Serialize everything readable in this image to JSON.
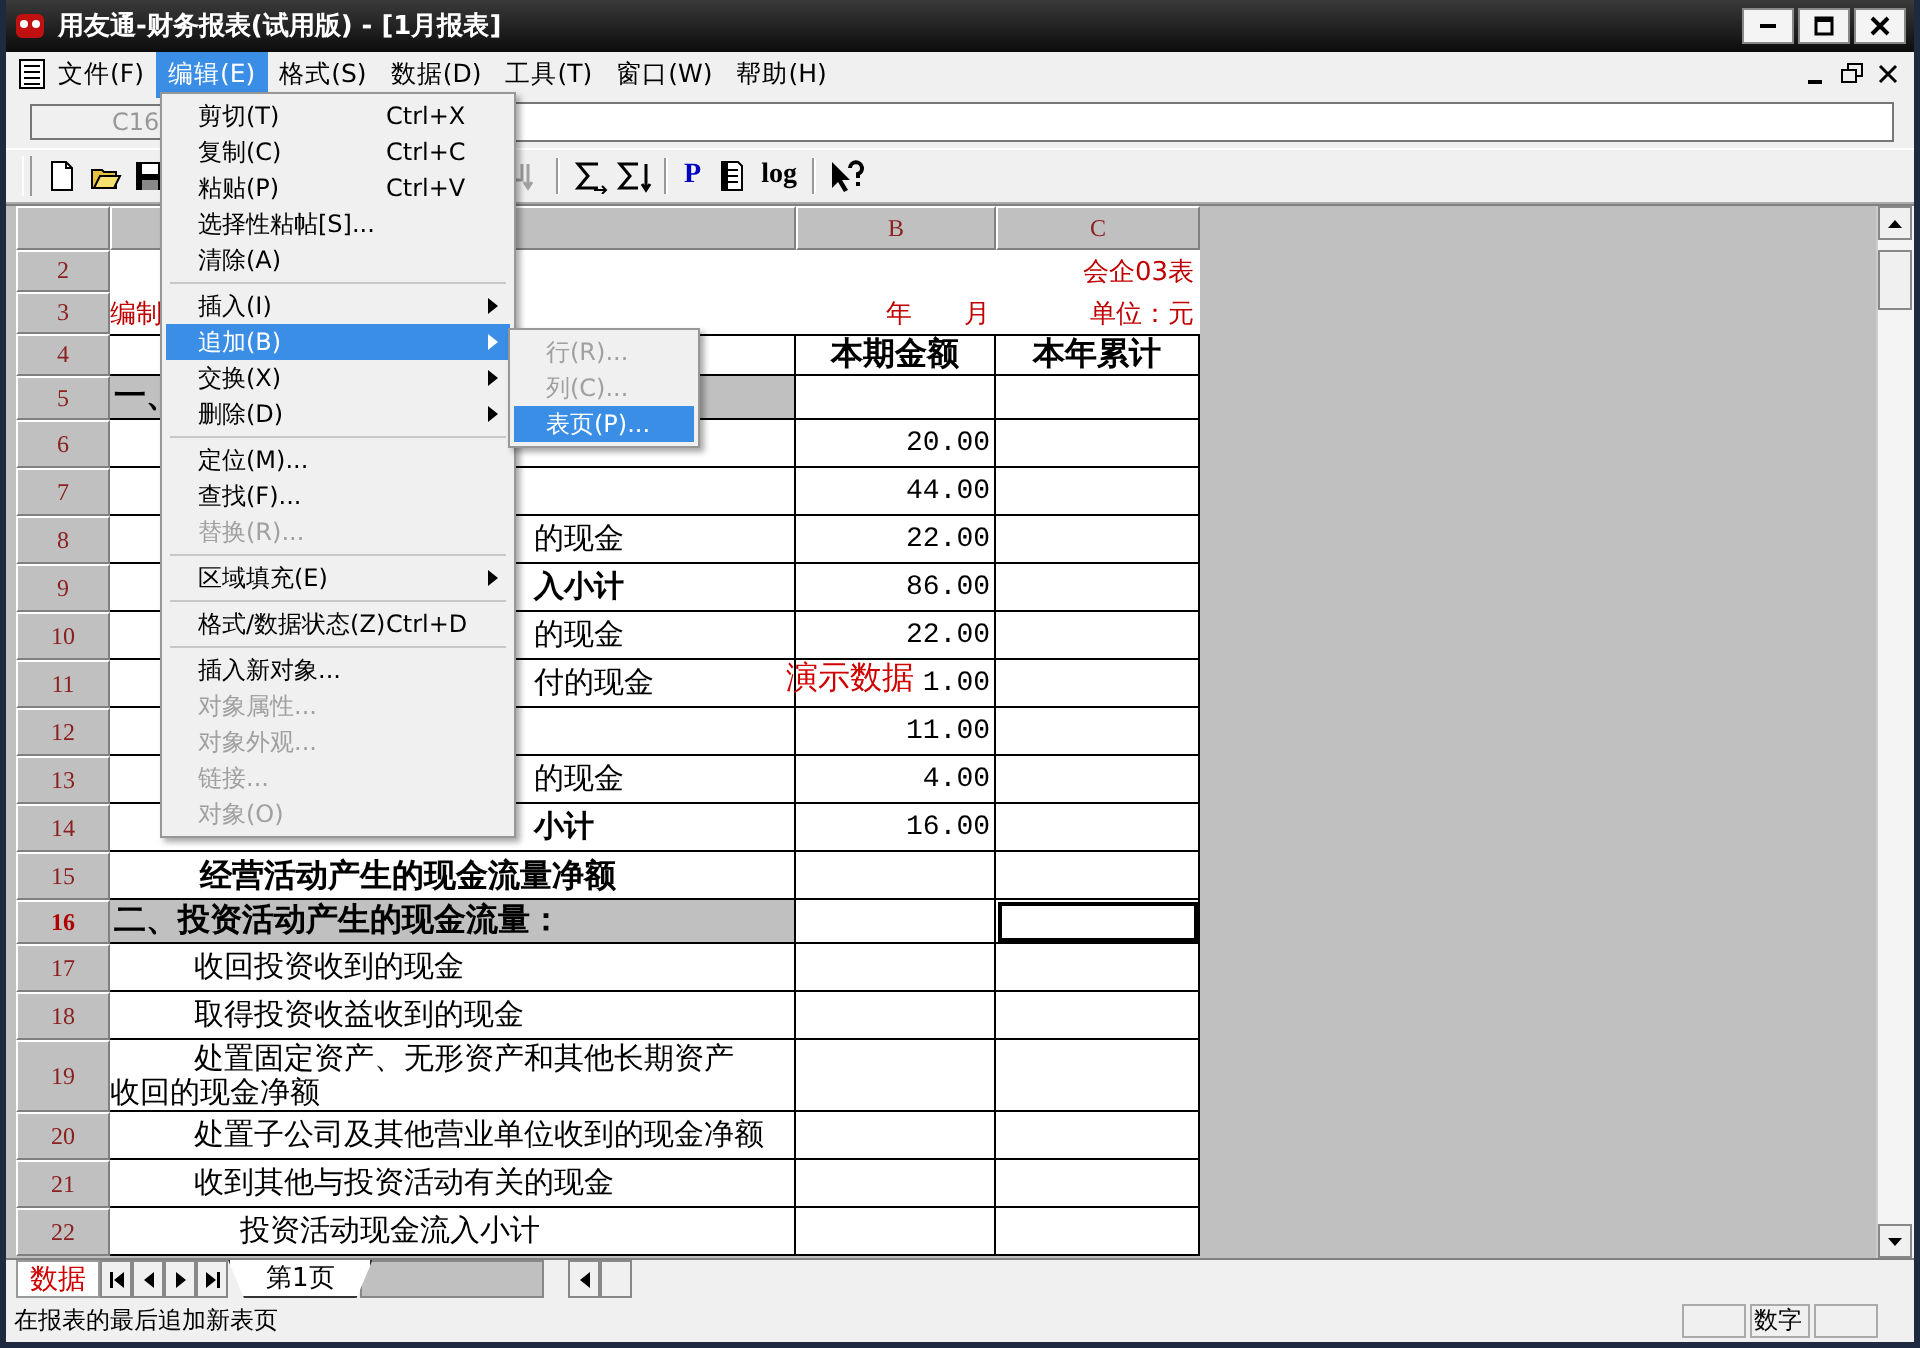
{
  "window": {
    "title": "用友通-财务报表(试用版) - [1月报表]"
  },
  "menubar": [
    {
      "label": "文件(F)",
      "selected": false
    },
    {
      "label": "编辑(E)",
      "selected": true
    },
    {
      "label": "格式(S)",
      "selected": false
    },
    {
      "label": "数据(D)",
      "selected": false
    },
    {
      "label": "工具(T)",
      "selected": false
    },
    {
      "label": "窗口(W)",
      "selected": false
    },
    {
      "label": "帮助(H)",
      "selected": false
    }
  ],
  "formula_bar": {
    "cell_ref": "C16"
  },
  "toolbar": {
    "left": [
      {
        "kind": "new",
        "disabled": false
      },
      {
        "kind": "open",
        "disabled": false
      },
      {
        "kind": "save",
        "disabled": false
      }
    ],
    "right_groups": [
      [
        {
          "kind": "sort",
          "disabled": true
        }
      ],
      [
        {
          "kind": "sum_right",
          "disabled": false
        },
        {
          "kind": "sum_down",
          "disabled": false
        }
      ],
      [
        {
          "kind": "text",
          "label": "P",
          "disabled": false
        },
        {
          "kind": "page",
          "disabled": false
        },
        {
          "kind": "text",
          "label": "log",
          "disabled": false
        }
      ],
      [
        {
          "kind": "help",
          "disabled": false
        }
      ]
    ]
  },
  "sheet": {
    "column_headers": [
      "B",
      "C"
    ],
    "rows": [
      {
        "number": "2",
        "kind": "title",
        "selected": false,
        "c": "会企03表"
      },
      {
        "number": "3",
        "kind": "title",
        "bold": false,
        "selected": false,
        "a": "编制",
        "b": "年　　月",
        "c": "单位：元"
      },
      {
        "number": "4",
        "kind": "header",
        "selected": false,
        "b": "本期金额",
        "c": "本年累计"
      },
      {
        "number": "5",
        "kind": "section",
        "bold": true,
        "selected": false,
        "a": "一、"
      },
      {
        "number": "6",
        "kind": "clipped",
        "selected": false,
        "b": "20.00"
      },
      {
        "number": "7",
        "kind": "item",
        "selected": false,
        "b": "44.00"
      },
      {
        "number": "8",
        "kind": "clipped",
        "bold": false,
        "selected": false,
        "a": "的现金",
        "b": "22.00"
      },
      {
        "number": "9",
        "kind": "clipped",
        "bold": true,
        "selected": false,
        "a": "入小计",
        "b": "86.00"
      },
      {
        "number": "10",
        "kind": "clipped",
        "bold": false,
        "selected": false,
        "a": "的现金",
        "b": "22.00"
      },
      {
        "number": "11",
        "kind": "clipped",
        "bold": false,
        "selected": false,
        "a": "付的现金",
        "b": "1.00"
      },
      {
        "number": "12",
        "kind": "item",
        "selected": false,
        "b": "11.00"
      },
      {
        "number": "13",
        "kind": "clipped",
        "bold": false,
        "selected": false,
        "a": "的现金",
        "b": "4.00"
      },
      {
        "number": "14",
        "kind": "clipped",
        "bold": true,
        "selected": false,
        "a": "小计",
        "b": "16.00"
      },
      {
        "number": "15",
        "kind": "total",
        "bold": true,
        "selected": false,
        "a": "经营活动产生的现金流量净额"
      },
      {
        "number": "16",
        "kind": "section",
        "bold": true,
        "selected": true,
        "a": "二、投资活动产生的现金流量："
      },
      {
        "number": "17",
        "kind": "item",
        "bold": false,
        "selected": false,
        "a": "收回投资收到的现金"
      },
      {
        "number": "18",
        "kind": "item",
        "bold": false,
        "selected": false,
        "a": "取得投资收益收到的现金"
      },
      {
        "number": "19",
        "kind": "item_wrap",
        "bold": false,
        "selected": false,
        "a": "处置固定资产、无形资产和其他长期资产收回的现金净额"
      },
      {
        "number": "20",
        "kind": "item",
        "bold": false,
        "selected": false,
        "a": "处置子公司及其他营业单位收到的现金净额"
      },
      {
        "number": "21",
        "kind": "item",
        "bold": false,
        "selected": false,
        "a": "收到其他与投资活动有关的现金"
      },
      {
        "number": "22",
        "kind": "subtotal",
        "bold": false,
        "selected": false,
        "a": "投资活动现金流入小计"
      }
    ],
    "demo_stamp": "演示数据"
  },
  "edit_menu": [
    {
      "kind": "item",
      "label": "剪切(T)",
      "shortcut": "Ctrl+X",
      "disabled": false,
      "selected": false,
      "submenu": false
    },
    {
      "kind": "item",
      "label": "复制(C)",
      "shortcut": "Ctrl+C",
      "disabled": false,
      "selected": false,
      "submenu": false
    },
    {
      "kind": "item",
      "label": "粘贴(P)",
      "shortcut": "Ctrl+V",
      "disabled": false,
      "selected": false,
      "submenu": false
    },
    {
      "kind": "item",
      "label": "选择性粘帖[S]...",
      "disabled": false,
      "selected": false,
      "submenu": false
    },
    {
      "kind": "item",
      "label": "清除(A)",
      "disabled": false,
      "selected": false,
      "submenu": false
    },
    {
      "kind": "separator"
    },
    {
      "kind": "item",
      "label": "插入(I)",
      "disabled": false,
      "selected": false,
      "submenu": true
    },
    {
      "kind": "item",
      "label": "追加(B)",
      "disabled": false,
      "selected": true,
      "submenu": true
    },
    {
      "kind": "item",
      "label": "交换(X)",
      "disabled": false,
      "selected": false,
      "submenu": true
    },
    {
      "kind": "item",
      "label": "删除(D)",
      "disabled": false,
      "selected": false,
      "submenu": true
    },
    {
      "kind": "separator"
    },
    {
      "kind": "item",
      "label": "定位(M)...",
      "disabled": false,
      "selected": false,
      "submenu": false
    },
    {
      "kind": "item",
      "label": "查找(F)...",
      "disabled": false,
      "selected": false,
      "submenu": false
    },
    {
      "kind": "item",
      "label": "替换(R)...",
      "disabled": true,
      "selected": false,
      "submenu": false
    },
    {
      "kind": "separator"
    },
    {
      "kind": "item",
      "label": "区域填充(E)",
      "disabled": false,
      "selected": false,
      "submenu": true
    },
    {
      "kind": "separator"
    },
    {
      "kind": "item",
      "label": "格式/数据状态(Z)",
      "shortcut": "Ctrl+D",
      "disabled": false,
      "selected": false,
      "submenu": false
    },
    {
      "kind": "separator"
    },
    {
      "kind": "item",
      "label": "插入新对象...",
      "disabled": false,
      "selected": false,
      "submenu": false
    },
    {
      "kind": "item",
      "label": "对象属性...",
      "disabled": true,
      "selected": false,
      "submenu": false
    },
    {
      "kind": "item",
      "label": "对象外观...",
      "disabled": true,
      "selected": false,
      "submenu": false
    },
    {
      "kind": "item",
      "label": "链接...",
      "disabled": true,
      "selected": false,
      "submenu": false
    },
    {
      "kind": "item",
      "label": "对象(O)",
      "disabled": true,
      "selected": false,
      "submenu": false
    }
  ],
  "append_submenu": [
    {
      "label": "行(R)...",
      "disabled": true,
      "selected": false
    },
    {
      "label": "列(C)...",
      "disabled": true,
      "selected": false
    },
    {
      "label": "表页(P)...",
      "disabled": false,
      "selected": true
    }
  ],
  "sheet_tabs": {
    "mode_label": "数据",
    "tabs": [
      {
        "label": "第1页",
        "selected": true
      }
    ]
  },
  "status_bar": {
    "message": "在报表的最后追加新表页",
    "panes": [
      "数字"
    ]
  }
}
